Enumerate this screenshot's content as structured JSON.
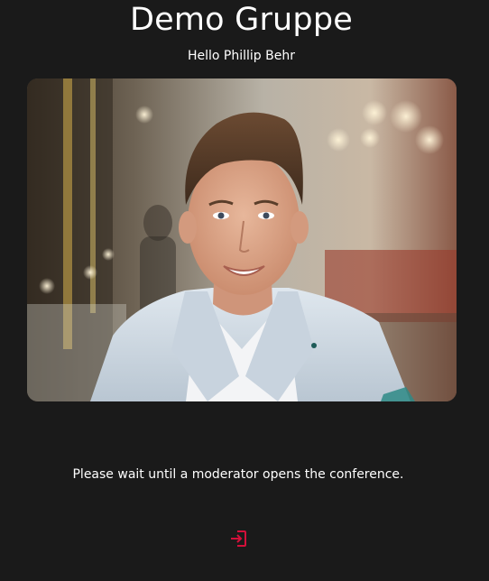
{
  "header": {
    "title": "Demo Gruppe",
    "greeting": "Hello Phillip Behr"
  },
  "video": {
    "participant": "Phillip Behr"
  },
  "status": {
    "message": "Please wait until a moderator opens the conference."
  },
  "actions": {
    "enter_icon": "login-icon"
  },
  "colors": {
    "background": "#1a1a1a",
    "accent": "#d3103a",
    "text": "#ffffff"
  }
}
